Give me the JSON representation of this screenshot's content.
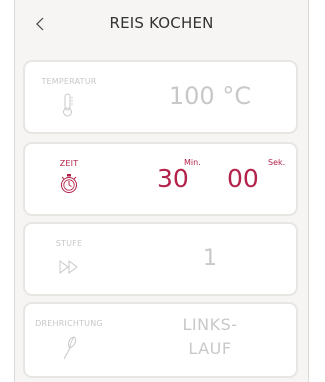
{
  "header": {
    "title": "REIS KOCHEN"
  },
  "cards": {
    "temperature": {
      "label": "TEMPERATUR",
      "value": "100 °C",
      "icon": "thermometer-icon"
    },
    "time": {
      "label": "ZEIT",
      "minutes": "30",
      "seconds": "00",
      "min_unit": "Min.",
      "sec_unit": "Sek.",
      "icon": "stopwatch-icon"
    },
    "stage": {
      "label": "STUFE",
      "value": "1",
      "icon": "fast-forward-icon"
    },
    "direction": {
      "label": "DREHRICHTUNG",
      "value_line1": "LINKS-",
      "value_line2": "LAUF",
      "icon": "whisk-icon"
    }
  },
  "colors": {
    "accent": "#b3224a",
    "disabled": "#c8c8c8",
    "background": "#f6f5f3"
  }
}
